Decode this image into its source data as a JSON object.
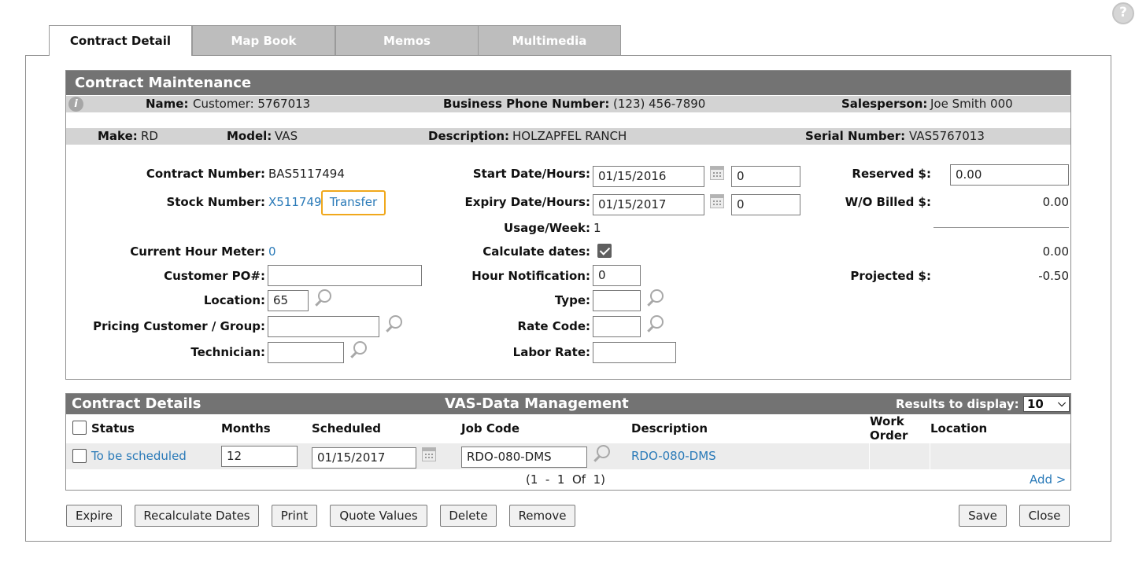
{
  "help": {
    "glyph": "?"
  },
  "tabs": [
    {
      "label": "Contract Detail",
      "active": true
    },
    {
      "label": "Map Book",
      "active": false
    },
    {
      "label": "Memos",
      "active": false
    },
    {
      "label": "Multimedia",
      "active": false
    }
  ],
  "maintenance": {
    "title": "Contract Maintenance",
    "info_glyph": "i",
    "name_label": "Name:",
    "name_value": "Customer: 5767013",
    "phone_label": "Business Phone Number:",
    "phone_value": "(123) 456-7890",
    "salesperson_label": "Salesperson:",
    "salesperson_value": "Joe Smith 000",
    "make_label": "Make:",
    "make_value": "RD",
    "model_label": "Model:",
    "model_value": "VAS",
    "description_label": "Description:",
    "description_value": "HOLZAPFEL RANCH",
    "serial_label": "Serial Number:",
    "serial_value": "VAS5767013"
  },
  "form": {
    "contract_number_label": "Contract Number:",
    "contract_number_value": "BAS5117494",
    "stock_number_label": "Stock Number:",
    "stock_number_value": "X511749",
    "transfer_label": "Transfer",
    "current_hour_meter_label": "Current Hour Meter:",
    "current_hour_meter_value": "0",
    "customer_po_label": "Customer PO#:",
    "customer_po_value": "",
    "location_label": "Location:",
    "location_value": "65",
    "pricing_label": "Pricing Customer / Group:",
    "pricing_value": "",
    "technician_label": "Technician:",
    "technician_value": "",
    "start_label": "Start Date/Hours:",
    "start_date": "01/15/2016",
    "start_hours": "0",
    "expiry_label": "Expiry Date/Hours:",
    "expiry_date": "01/15/2017",
    "expiry_hours": "0",
    "usage_label": "Usage/Week:",
    "usage_value": "1",
    "calculate_label": "Calculate dates:",
    "calculate_checked": true,
    "hour_notification_label": "Hour Notification:",
    "hour_notification_value": "0",
    "type_label": "Type:",
    "type_value": "",
    "rate_code_label": "Rate Code:",
    "rate_code_value": "",
    "labor_rate_label": "Labor Rate:",
    "labor_rate_value": "",
    "reserved_label": "Reserved $:",
    "reserved_value": "0.00",
    "wo_billed_label": "W/O Billed $:",
    "wo_billed_value": "0.00",
    "subtotal_value": "0.00",
    "projected_label": "Projected $:",
    "projected_value": "-0.50"
  },
  "details": {
    "title": "Contract Details",
    "subtitle": "VAS-Data Management",
    "results_label": "Results to display:",
    "results_value": "10",
    "columns": {
      "status": "Status",
      "months": "Months",
      "scheduled": "Scheduled",
      "job_code": "Job Code",
      "description": "Description",
      "work_order_1": "Work",
      "work_order_2": "Order",
      "location": "Location"
    },
    "rows": [
      {
        "status": "To be scheduled",
        "months": "12",
        "scheduled": "01/15/2017",
        "job_code": "RDO-080-DMS",
        "description": "RDO-080-DMS",
        "work_order": "",
        "location": ""
      }
    ],
    "pagination": "(1  -  1  Of  1)",
    "add_label": "Add >"
  },
  "buttons": {
    "expire": "Expire",
    "recalculate": "Recalculate Dates",
    "print": "Print",
    "quote_values": "Quote Values",
    "delete": "Delete",
    "remove": "Remove",
    "save": "Save",
    "close": "Close"
  }
}
